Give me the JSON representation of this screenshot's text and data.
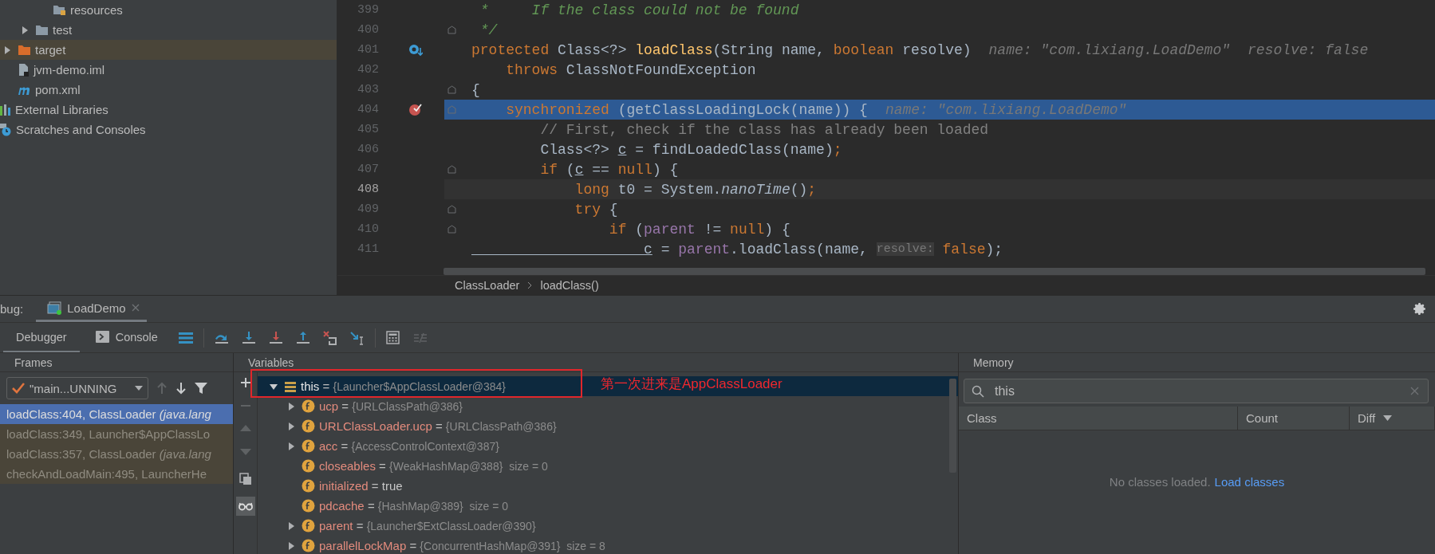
{
  "project_tree": [
    {
      "children": [
        {
          "children": [
            {
              "children": [
                {
                  "label": "resources",
                  "kind": "resources-folder",
                  "selected": false
                }
              ]
            },
            {
              "label": "test",
              "kind": "folder",
              "expanded": false,
              "selected": false
            }
          ]
        },
        {
          "label": "target",
          "kind": "excluded-folder",
          "expanded": false,
          "selected": true
        },
        {
          "label": "jvm-demo.iml",
          "kind": "module-file",
          "selected": false
        },
        {
          "label": "pom.xml",
          "kind": "maven-file",
          "selected": false
        }
      ]
    },
    {
      "label": "External Libraries",
      "kind": "libraries",
      "selected": false
    },
    {
      "label": "Scratches and Consoles",
      "kind": "scratches",
      "selected": false
    }
  ],
  "editor": {
    "lines": [
      {
        "number": "399",
        "fold": false,
        "execution": false,
        "caret": false,
        "tokens": [
          {
            "text": " *     If the class could not be found",
            "kind": "doc"
          }
        ]
      },
      {
        "number": "400",
        "fold": true,
        "execution": false,
        "caret": false,
        "tokens": [
          {
            "text": " */",
            "kind": "doc"
          }
        ]
      },
      {
        "number": "401",
        "fold": false,
        "execution": false,
        "caret": false,
        "gutter": {
          "kind": "method-breakpoint"
        },
        "tokens": [
          {
            "text": "protected",
            "kind": "keyword"
          },
          {
            "text": " Class<?> ",
            "kind": "plain"
          },
          {
            "text": "loadClass",
            "kind": "method"
          },
          {
            "text": "(String name, ",
            "kind": "plain"
          },
          {
            "text": "boolean",
            "kind": "keyword"
          },
          {
            "text": " resolve)",
            "kind": "plain"
          },
          {
            "text": "name: \"com.lixiang.LoadDemo\"",
            "kind": "hint"
          },
          {
            "text": "resolve: false",
            "kind": "hint"
          }
        ]
      },
      {
        "number": "402",
        "fold": false,
        "execution": false,
        "caret": false,
        "tokens": [
          {
            "text": "    throws",
            "kind": "keyword"
          },
          {
            "text": " ClassNotFoundException",
            "kind": "plain"
          }
        ]
      },
      {
        "number": "403",
        "fold": true,
        "execution": false,
        "caret": false,
        "tokens": [
          {
            "text": "{",
            "kind": "plain"
          }
        ]
      },
      {
        "number": "404",
        "fold": true,
        "execution": true,
        "caret": false,
        "gutter": {
          "kind": "breakpoint"
        },
        "tokens": [
          {
            "text": "    synchronized",
            "kind": "keyword"
          },
          {
            "text": " (getClassLoadingLock(name)) {",
            "kind": "plain"
          },
          {
            "text": "name: \"com.lixiang.LoadDemo\"",
            "kind": "hint"
          }
        ]
      },
      {
        "number": "405",
        "fold": false,
        "execution": false,
        "caret": false,
        "tokens": [
          {
            "text": "        // First, check if the class has already been loaded",
            "kind": "comment"
          }
        ]
      },
      {
        "number": "406",
        "fold": false,
        "execution": false,
        "caret": false,
        "tokens": [
          {
            "text": "        Class<?> ",
            "kind": "plain"
          },
          {
            "text": "c",
            "kind": "local"
          },
          {
            "text": " = findLoadedClass(name)",
            "kind": "plain"
          },
          {
            "text": ";",
            "kind": "keyword"
          }
        ]
      },
      {
        "number": "407",
        "fold": true,
        "execution": false,
        "caret": false,
        "tokens": [
          {
            "text": "        if",
            "kind": "keyword"
          },
          {
            "text": " (",
            "kind": "plain"
          },
          {
            "text": "c",
            "kind": "local"
          },
          {
            "text": " == ",
            "kind": "plain"
          },
          {
            "text": "null",
            "kind": "keyword"
          },
          {
            "text": ") {",
            "kind": "plain"
          }
        ]
      },
      {
        "number": "408",
        "fold": false,
        "execution": false,
        "caret": true,
        "tokens": [
          {
            "text": "            long",
            "kind": "keyword"
          },
          {
            "text": " t0 = System.",
            "kind": "plain"
          },
          {
            "text": "nanoTime",
            "kind": "static"
          },
          {
            "text": "()",
            "kind": "plain"
          },
          {
            "text": ";",
            "kind": "keyword"
          }
        ]
      },
      {
        "number": "409",
        "fold": true,
        "execution": false,
        "caret": false,
        "tokens": [
          {
            "text": "            try",
            "kind": "keyword"
          },
          {
            "text": " {",
            "kind": "plain"
          }
        ]
      },
      {
        "number": "410",
        "fold": true,
        "execution": false,
        "caret": false,
        "tokens": [
          {
            "text": "                if",
            "kind": "keyword"
          },
          {
            "text": " (",
            "kind": "plain"
          },
          {
            "text": "parent",
            "kind": "field"
          },
          {
            "text": " != ",
            "kind": "plain"
          },
          {
            "text": "null",
            "kind": "keyword"
          },
          {
            "text": ") {",
            "kind": "plain"
          }
        ]
      },
      {
        "number": "411",
        "fold": false,
        "execution": false,
        "caret": false,
        "tokens": [
          {
            "text": "                    c",
            "kind": "local"
          },
          {
            "text": " = ",
            "kind": "plain"
          },
          {
            "text": "parent",
            "kind": "field"
          },
          {
            "text": ".loadClass(name, ",
            "kind": "plain"
          },
          {
            "text": "resolve:",
            "kind": "param-hint"
          },
          {
            "text": " false",
            "kind": "keyword"
          },
          {
            "text": ");",
            "kind": "plain"
          }
        ]
      }
    ],
    "breadcrumbs": [
      "ClassLoader",
      "loadClass()"
    ]
  },
  "debug": {
    "label": "bug:",
    "tabs": [
      {
        "label": "LoadDemo",
        "selected": true
      }
    ],
    "view_tabs": [
      {
        "label": "Debugger",
        "kind": "debugger",
        "selected": true
      },
      {
        "label": "Console",
        "kind": "console",
        "selected": false
      }
    ]
  },
  "frames": {
    "title": "Frames",
    "thread": "\"main...UNNING",
    "items": [
      {
        "text": "loadClass:404, ClassLoader *(java.lang*",
        "selected": true
      },
      {
        "text": "loadClass:349, Launcher$AppClassLo",
        "selected": false
      },
      {
        "text": "loadClass:357, ClassLoader *(java.lang*",
        "selected": false
      },
      {
        "text": "checkAndLoadMain:495, LauncherHe",
        "selected": false
      }
    ]
  },
  "variables": {
    "title": "Variables",
    "items": [
      {
        "name": "this",
        "operator": "=",
        "value": "{Launcher$AppClassLoader@384}",
        "kind": "object",
        "primitive": false,
        "expanded": true,
        "selected": true,
        "children": [
          {
            "name": "ucp",
            "operator": "=",
            "value": "{URLClassPath@386}",
            "kind": "field",
            "primitive": false,
            "expanded": false,
            "selected": false
          },
          {
            "name": "URLClassLoader.ucp",
            "operator": "=",
            "value": "{URLClassPath@386}",
            "kind": "field",
            "primitive": false,
            "expanded": false,
            "selected": false
          },
          {
            "name": "acc",
            "operator": "=",
            "value": "{AccessControlContext@387}",
            "kind": "field",
            "primitive": false,
            "expanded": false,
            "selected": false
          },
          {
            "name": "closeables",
            "operator": "=",
            "value": "{WeakHashMap@388}",
            "extra": "size = 0",
            "kind": "field",
            "primitive": false,
            "selected": false
          },
          {
            "name": "initialized",
            "operator": "=",
            "value": "true",
            "kind": "field",
            "primitive": true,
            "selected": false
          },
          {
            "name": "pdcache",
            "operator": "=",
            "value": "{HashMap@389}",
            "extra": "size = 0",
            "kind": "field",
            "primitive": false,
            "selected": false
          },
          {
            "name": "parent",
            "operator": "=",
            "value": "{Launcher$ExtClassLoader@390}",
            "kind": "field",
            "primitive": false,
            "expanded": false,
            "selected": false
          },
          {
            "name": "parallelLockMap",
            "operator": "=",
            "value": "{ConcurrentHashMap@391}",
            "extra": "size = 8",
            "kind": "field",
            "primitive": false,
            "expanded": false,
            "selected": false
          }
        ]
      }
    ],
    "annotation": "第一次进来是AppClassLoader"
  },
  "memory": {
    "title": "Memory",
    "search": {
      "value": "this"
    },
    "columns": [
      "Class",
      "Count",
      "Diff"
    ],
    "empty_text": "No classes loaded.",
    "link": "Load classes"
  }
}
